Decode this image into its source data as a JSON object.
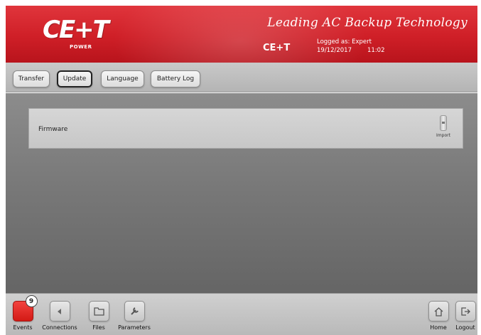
{
  "header": {
    "logo_text": "CE+T",
    "logo_subtext": "POWER",
    "tagline": "Leading AC Backup Technology",
    "brand": "CE+T",
    "logged_as": "Logged as: Expert",
    "date": "19/12/2017",
    "time": "11:02"
  },
  "toolbar": {
    "tabs": [
      {
        "label": "Transfer"
      },
      {
        "label": "Update"
      },
      {
        "label": "Language"
      },
      {
        "label": "Battery Log"
      }
    ],
    "active_tab": "Update"
  },
  "main": {
    "firmware_label": "Firmware",
    "import_label": "Import"
  },
  "bottom_nav": {
    "events": {
      "label": "Events",
      "badge": "9"
    },
    "connections": {
      "label": "Connections"
    },
    "files": {
      "label": "Files"
    },
    "parameters": {
      "label": "Parameters"
    },
    "home": {
      "label": "Home"
    },
    "logout": {
      "label": "Logout"
    }
  },
  "colors": {
    "header_red": "#cf1f27",
    "events_red": "#e0302b"
  }
}
